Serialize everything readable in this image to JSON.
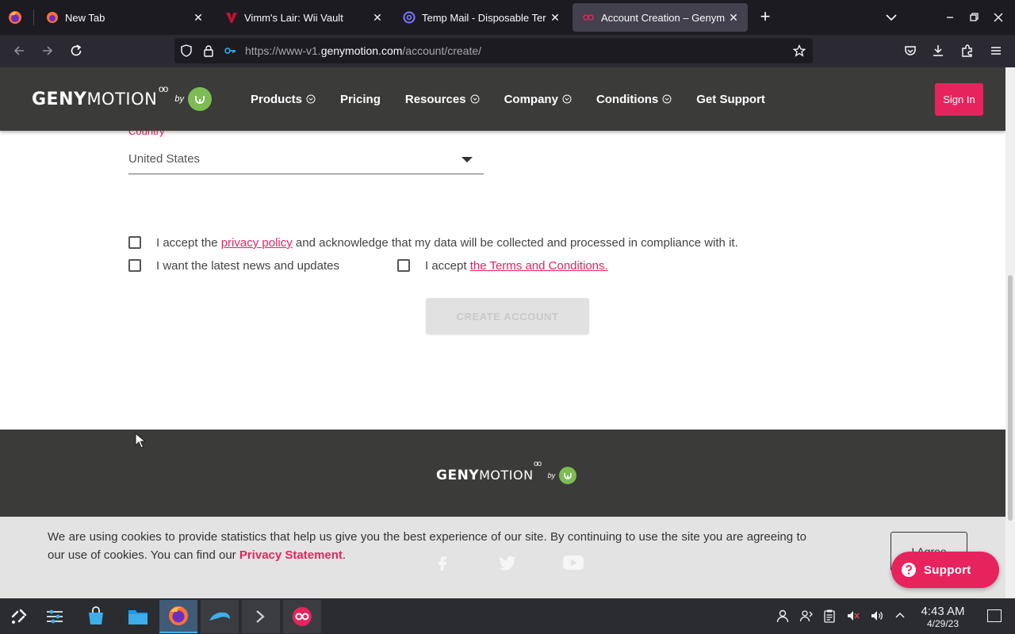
{
  "browser": {
    "tabs": [
      {
        "title": "New Tab",
        "favicon": "firefox-icon",
        "active": false
      },
      {
        "title": "Vimm's Lair: Wii Vault",
        "favicon": "vimm-icon",
        "active": false
      },
      {
        "title": "Temp Mail - Disposable Ter",
        "favicon": "tempmail-icon",
        "active": false
      },
      {
        "title": "Account Creation – Genym",
        "favicon": "genymotion-icon",
        "active": true
      }
    ],
    "url": {
      "prefix": "https://www-v1.",
      "domain": "genymotion.com",
      "path": "/account/create/"
    }
  },
  "site": {
    "logo": {
      "bold": "GENY",
      "light": "MOTION",
      "oo": "oo",
      "by": "by"
    },
    "nav": [
      {
        "label": "Products",
        "has_dropdown": true
      },
      {
        "label": "Pricing",
        "has_dropdown": false
      },
      {
        "label": "Resources",
        "has_dropdown": true
      },
      {
        "label": "Company",
        "has_dropdown": true
      },
      {
        "label": "Conditions",
        "has_dropdown": true
      },
      {
        "label": "Get Support",
        "has_dropdown": false
      }
    ],
    "signin_label": "Sign In",
    "accent": "#e7235d",
    "header_bg": "#3b3b3a"
  },
  "form": {
    "country_label": "Country",
    "country_value": "United States",
    "privacy": {
      "before": "I accept the ",
      "link": "privacy policy",
      "after": " and acknowledge that my data will be collected and processed in compliance with it.",
      "checked": false
    },
    "news": {
      "label": "I want the latest news and updates",
      "checked": false
    },
    "terms": {
      "before": "I accept ",
      "link": "the Terms and Conditions.",
      "checked": false
    },
    "create_label": "CREATE ACCOUNT",
    "create_enabled": false
  },
  "footer": {
    "social": [
      "facebook-icon",
      "twitter-icon",
      "youtube-icon"
    ]
  },
  "cookie": {
    "text": "We are using cookies to provide statistics that help us give you the best experience of our site. By continuing to use the site you are agreeing to our use of cookies. You can find our ",
    "link": "Privacy Statement",
    "after": ".",
    "agree_label": "I Agree"
  },
  "support_label": "Support",
  "taskbar": {
    "time": "4:43 AM",
    "date": "4/29/23"
  }
}
